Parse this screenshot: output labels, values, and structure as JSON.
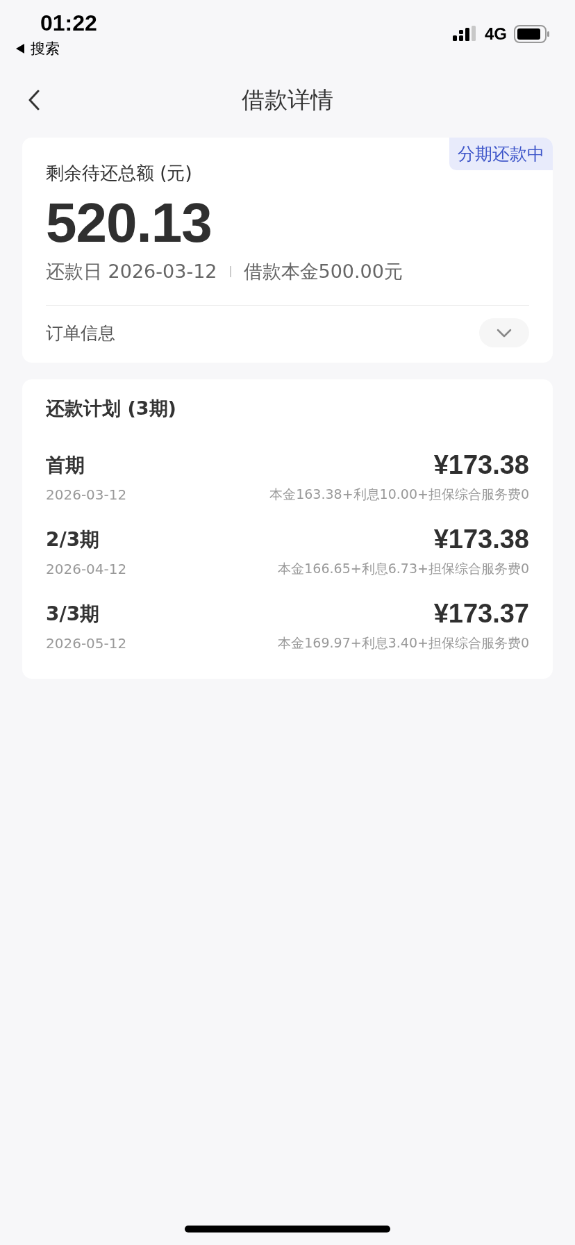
{
  "status_bar": {
    "time": "01:22",
    "back_app": "搜索",
    "network": "4G"
  },
  "nav": {
    "title": "借款详情"
  },
  "summary": {
    "badge": "分期还款中",
    "label": "剩余待还总额 (元)",
    "amount": "520.13",
    "due_date": "还款日 2026-03-12",
    "principal": "借款本金500.00元",
    "order_info": {
      "label": "订单信息",
      "expanded": false
    }
  },
  "plan": {
    "title": "还款计划 (3期)",
    "items": [
      {
        "period": "首期",
        "date": "2026-03-12",
        "amount": "¥173.38",
        "detail": "本金163.38+利息10.00+担保综合服务费0"
      },
      {
        "period": "2/3期",
        "date": "2026-04-12",
        "amount": "¥173.38",
        "detail": "本金166.65+利息6.73+担保综合服务费0"
      },
      {
        "period": "3/3期",
        "date": "2026-05-12",
        "amount": "¥173.37",
        "detail": "本金169.97+利息3.40+担保综合服务费0"
      }
    ]
  }
}
